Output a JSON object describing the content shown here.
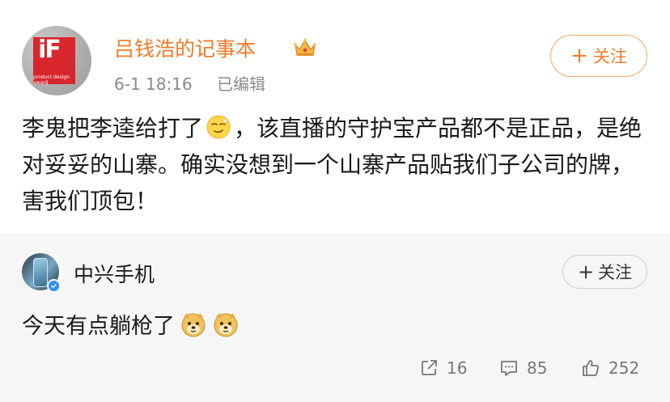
{
  "post": {
    "author": "吕钱浩的记事本",
    "time": "6-1 18:16",
    "edited": "已编辑",
    "follow_label": "关注",
    "follow_plus": "+",
    "text_part1": "李鬼把李逵给打了",
    "text_part2": "，该直播的守护宝产品都不是正品，是绝对妥妥的山寨。确实没想到一个山寨产品贴我们子公司的牌，害我们顶包！",
    "avatar_text_big": "iF",
    "avatar_text_small": "product design award"
  },
  "repost": {
    "author": "中兴手机",
    "follow_label": "关注",
    "follow_plus": "+",
    "text": "今天有点躺枪了"
  },
  "actions": {
    "share_count": "16",
    "comment_count": "85",
    "like_count": "252"
  },
  "colors": {
    "accent": "#f07b2b",
    "verified": "#2e8ff0",
    "repost_bg": "#f6f6f6"
  }
}
